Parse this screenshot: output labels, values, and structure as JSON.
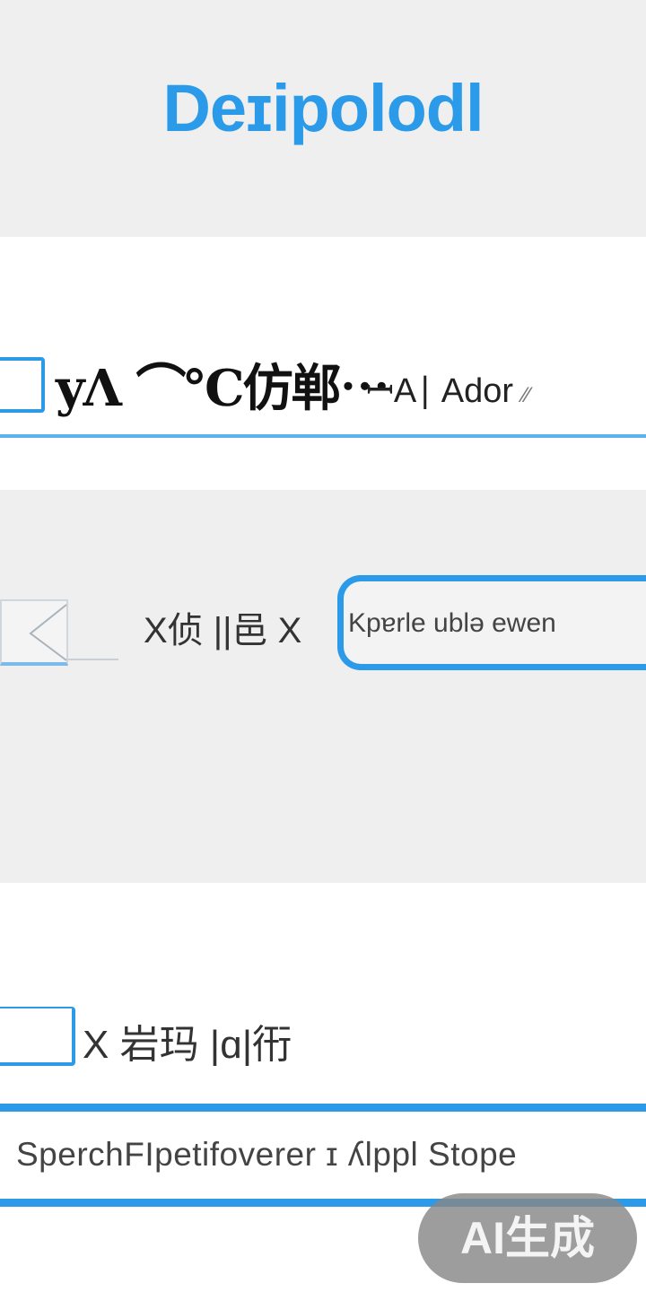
{
  "header": {
    "title": "Deɪipolodl"
  },
  "row1": {
    "label": "yΛ ⌒℃仿郸⋯",
    "hint": "ꟷA∣ Ador",
    "extra": "⁄⁄"
  },
  "row2": {
    "label": "X侦 ||邑 X",
    "input_value": "Kpɐrle ublə ewen"
  },
  "row3": {
    "label": "X 岩玛 |ɑ|衎"
  },
  "search": {
    "value": "SperchFIpetifoverer ɪ ʎlppl Stope"
  },
  "badge": {
    "label": "AI生成"
  },
  "colors": {
    "accent": "#2b9ae8",
    "header_bg": "#efefef",
    "section_bg": "#ffffff"
  },
  "icons": {
    "back": "chevron-left-icon",
    "close": "close-icon"
  }
}
